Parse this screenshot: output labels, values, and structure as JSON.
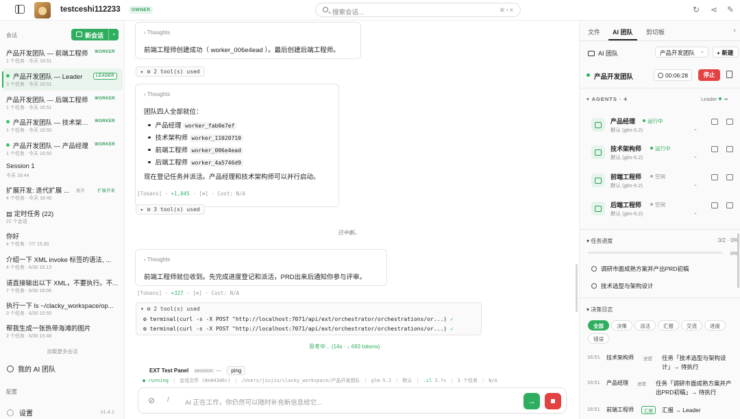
{
  "topbar": {
    "workspace": "testceshi112233",
    "owner_badge": "OWNER",
    "search_placeholder": "搜索会话...",
    "search_shortcut": "⌘ + K"
  },
  "sidebar": {
    "section_label": "会话",
    "new_chat": "新会话",
    "conversations": [
      {
        "title": "产品开发团队 — 前端工程师",
        "meta": "1 个任务 · 今天 16:51",
        "badge": "WORKER"
      },
      {
        "title": "产品开发团队 — Leader",
        "meta": "3 个任务 · 今天 16:51",
        "badge": "LEADER"
      },
      {
        "title": "产品开发团队 — 后端工程师",
        "meta": "1 个任务 · 今天 16:51",
        "badge": "WORKER"
      },
      {
        "title": "产品开发团队 — 技术架构师",
        "meta": "1 个任务 · 今天 16:50",
        "badge": "WORKER"
      },
      {
        "title": "产品开发团队 — 产品经理",
        "meta": "1 个任务 · 今天 16:50",
        "badge": "WORKER"
      },
      {
        "title": "Session 1",
        "meta": "今天 16:44",
        "badge": ""
      },
      {
        "title": "扩展开发: 迭代扩展 ...",
        "meta": "4 个任务 · 今天 16:40",
        "badge": "扩展开发",
        "badge2": "暂存"
      },
      {
        "title": "定时任务 (22)",
        "meta": "22 个会话",
        "badge": ""
      },
      {
        "title": "你好",
        "meta": "4 个任务 · 7/7 15:30",
        "badge": ""
      },
      {
        "title": "介绍一下 XML invoke 标签的语法, ...",
        "meta": "4 个任务 · 6/30 16:13",
        "badge": ""
      },
      {
        "title": "请直接输出以下 XML，不要执行。不...",
        "meta": "7 个任务 · 6/30 16:06",
        "badge": ""
      },
      {
        "title": "执行一下 ls ~/clacky_workspace/op...",
        "meta": "3 个任务 · 6/30 15:55",
        "badge": ""
      },
      {
        "title": "帮我生成一张热带海滩的图片",
        "meta": "2 个任务 · 6/30 15:48",
        "badge": ""
      }
    ],
    "load_more": "加载更多会话",
    "my_team": "我的 AI 团队",
    "config_label": "配置",
    "settings": "设置",
    "version": "v1.4.1"
  },
  "main": {
    "card1": {
      "label": "Thoughts",
      "text": "前端工程师创建成功（ worker_006e4ead ）。最后创建后端工程师。"
    },
    "tools1": "▸ ⚙ 2 tool(s) used",
    "card2": {
      "label": "Thoughts",
      "intro": "团队四人全部就位：",
      "members": [
        {
          "role": "产品经理",
          "id": "worker_fab0e7ef"
        },
        {
          "role": "技术架构师",
          "id": "worker_11020710"
        },
        {
          "role": "前端工程师",
          "id": "worker_006e4ead"
        },
        {
          "role": "后端工程师",
          "id": "worker_4a5746d9"
        }
      ],
      "outro": "现在登记任务并派活。产品经理和技术架构师可以并行启动。"
    },
    "tokens1": {
      "label": "[Tokens]",
      "delta": "+1,045",
      "flag": "[≡]",
      "cost": "Cost: N/A"
    },
    "tools2": "▸ ⚙ 3 tool(s) used",
    "interrupted": "已中断。",
    "card3": {
      "label": "Thoughts",
      "text": "前端工程师就位收到。先完成进度登记和派活，PRD出来后通知你参与评审。"
    },
    "tokens2": {
      "label": "[Tokens]",
      "delta": "+327",
      "flag": "[≡]",
      "cost": "Cost: N/A"
    },
    "tools3": {
      "header": "▾ ⚙ 2 tool(s) used",
      "lines": [
        "⚙ terminal(curl -s -X POST \"http://localhost:7071/api/ext/orchestrator/orchestrations/or...)",
        "⚙ terminal(curl -s -X POST \"http://localhost:7071/api/ext/orchestrator/orchestrations/or...)"
      ],
      "ok": "✓"
    },
    "thinking": "思考中... (14s · ↓ 693 tokens)",
    "ext_panel": {
      "title": "EXT Test Panel",
      "session": "session: —",
      "ping": "ping"
    },
    "status": {
      "running": "● running",
      "file": "会话文件 (8e843d6c)",
      "path": "/Users/jiujiu/clacky_workspace/产品开发团队",
      "model": "glm-5.2",
      "mode": "默认",
      "speed": "2.7s",
      "tasks": "3 个任务",
      "cost": "N/A"
    },
    "composer": {
      "slash": "/",
      "placeholder": "AI 正在工作，你仍然可以随时补充新信息给它...",
      "send": "→"
    }
  },
  "right_panel": {
    "tabs": [
      "文件",
      "AI 团队",
      "剪切板"
    ],
    "active_tab": 1,
    "header": "AI 团队",
    "team_select": "产品开发团队",
    "new_btn": "+ 新建",
    "team_name": "产品开发团队",
    "timer": "00:06:28",
    "stop": "停止",
    "agents_header": "AGENTS · 4",
    "leader_label": "Leader",
    "agents": [
      {
        "name": "产品经理",
        "status": "运行中",
        "state": "run",
        "model": "默认 (glm-5.2)"
      },
      {
        "name": "技术架构师",
        "status": "运行中",
        "state": "run",
        "model": "默认 (glm-5.2)"
      },
      {
        "name": "前端工程师",
        "status": "空闲",
        "state": "idle",
        "model": "默认 (glm-5.2)"
      },
      {
        "name": "后端工程师",
        "status": "空闲",
        "state": "idle",
        "model": "默认 (glm-5.2)"
      }
    ],
    "progress": {
      "label": "任务进度",
      "count": "0/2 · 0%",
      "pct": "0%",
      "fraction": 0
    },
    "tasks": [
      "调研市面成熟方案并产出PRD初稿",
      "技术选型与架构设计"
    ],
    "log": {
      "label": "决策日志",
      "chips": [
        "全部",
        "决策",
        "派活",
        "汇报",
        "交流",
        "进度",
        "错误"
      ],
      "entries": [
        {
          "time": "16:51",
          "who": "技术架构师",
          "tag": "进度",
          "msg": "任务「技术选型与架构设计」→ 待执行"
        },
        {
          "time": "16:51",
          "who": "产品经理",
          "tag": "进度",
          "msg": "任务「调研市面成熟方案并产出PRD初稿」→ 待执行"
        },
        {
          "time": "16:51",
          "who": "前端工程师",
          "tag": "汇报",
          "msg": "汇报 → Leader"
        }
      ]
    }
  }
}
